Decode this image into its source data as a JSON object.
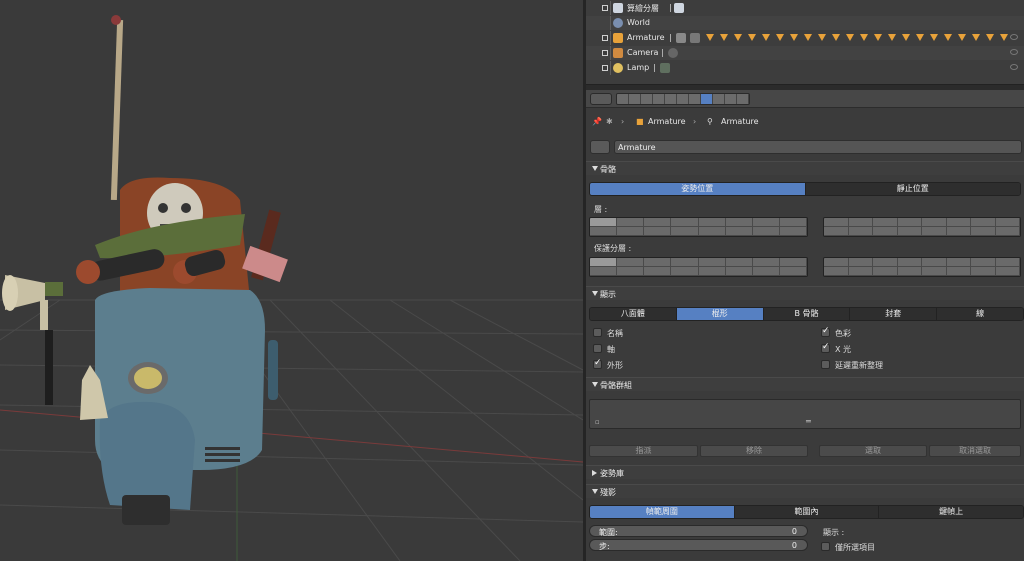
{
  "outliner": {
    "rows": [
      {
        "label": "算繪分層",
        "icon": "render-layers-icon"
      },
      {
        "label": "World",
        "icon": "world-icon"
      },
      {
        "label": "Armature",
        "icon": "armature-icon"
      },
      {
        "label": "Camera",
        "icon": "camera-icon"
      },
      {
        "label": "Lamp",
        "icon": "lamp-icon"
      }
    ]
  },
  "breadcrumb": {
    "object": "Armature",
    "data": "Armature"
  },
  "name_field": {
    "value": "Armature"
  },
  "skeleton": {
    "title": "骨骼",
    "mode_tabs": [
      "姿勢位置",
      "靜止位置"
    ],
    "active_mode": "姿勢位置",
    "layers_label": "層 :",
    "protected_layers_label": "保護分層 :"
  },
  "display": {
    "title": "顯示",
    "tabs": [
      "八面體",
      "棍形",
      "B 骨骼",
      "封套",
      "線"
    ],
    "active_tab": "棍形",
    "options": {
      "names": "名稱",
      "axes": "軸",
      "shapes": "外形",
      "colors": "色彩",
      "xray": "X 光",
      "delay_deform": "延遲重新整理"
    }
  },
  "bone_groups": {
    "title": "骨骼群組",
    "buttons": [
      "指派",
      "移除",
      "選取",
      "取消選取"
    ]
  },
  "pose_library": {
    "title": "姿勢庫"
  },
  "ghost": {
    "title": "殘影",
    "tabs": [
      "幀範周圍",
      "範圍內",
      "鍵幀上"
    ],
    "active_tab": "幀範周圍",
    "range_label": "範圍:",
    "range_value": "0",
    "step_label": "步:",
    "step_value": "0",
    "display_label": "顯示 :",
    "selected_only": "僅所選項目"
  },
  "colors": {
    "accent": "#5680c2",
    "panel": "#3b3b3b",
    "viewport": "#3a3a3a"
  }
}
